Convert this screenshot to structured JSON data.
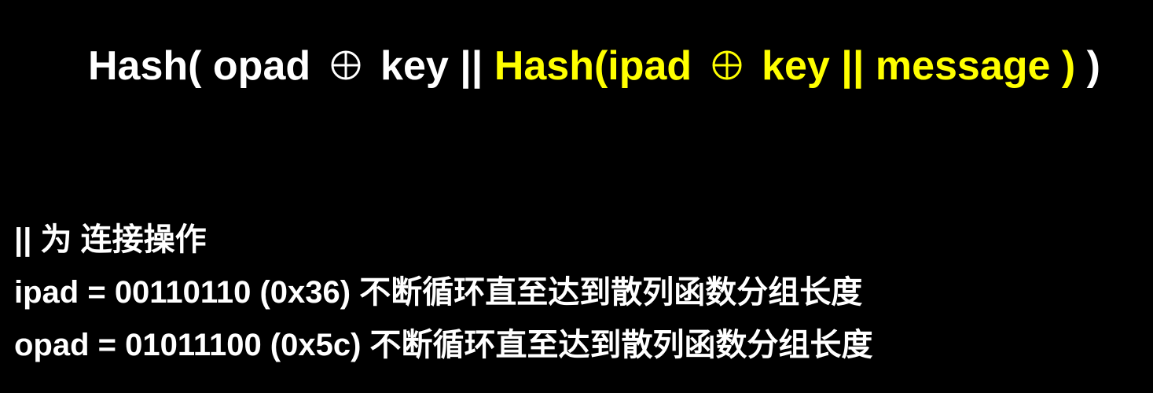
{
  "formula": {
    "outer_open": "Hash( opad",
    "outer_key": "key ||",
    "inner_open": "Hash(ipad",
    "inner_rest": "key || message )",
    "outer_close": ")",
    "xor_symbol": "xor-circle-plus-icon",
    "colors": {
      "outer": "#ffffff",
      "inner": "#ffff00"
    }
  },
  "notes": {
    "line1": "|| 为 连接操作",
    "line2": "ipad = 00110110 (0x36) 不断循环直至达到散列函数分组长度",
    "line3": "opad = 01011100 (0x5c) 不断循环直至达到散列函数分组长度"
  }
}
